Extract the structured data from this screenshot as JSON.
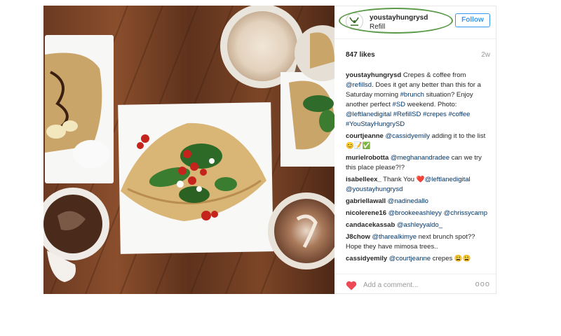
{
  "post": {
    "username": "youstayhungrysd",
    "location": "Refill",
    "follow_label": "Follow",
    "likes": "847 likes",
    "time_ago": "2w",
    "caption": {
      "user": "youstayhungrysd",
      "t1": " Crepes & coffee from ",
      "m1": "@refillsd",
      "t2": ". Does it get any better than this for a Saturday morning ",
      "h1": "#brunch",
      "t3": " situation? Enjoy another perfect ",
      "h2": "#SD",
      "t4": " weekend. Photo: ",
      "m2": "@leftlanedigital",
      "t5": " ",
      "h3": "#RefillSD",
      "t6": " ",
      "h4": "#crepes",
      "t7": " ",
      "h5": "#coffee",
      "t8": " ",
      "h6": "#YouStayHungrySD"
    },
    "comments": [
      {
        "user": "courtjeanne",
        "mention": "@cassidyemily",
        "text": " adding it to the list 😊📝✅"
      },
      {
        "user": "murielrobotta",
        "mention": "@meghanandradee",
        "text": " can we try this place please?!?"
      },
      {
        "user": "isabelleex_",
        "text": " Thank You ❤️",
        "mention": "@leftlanedigital",
        "mention2": "@youstayhungrysd"
      },
      {
        "user": "gabriellawall",
        "mention": "@nadinedallo"
      },
      {
        "user": "nicolerene16",
        "mention": "@brookeeashleyy",
        "mention2": "@chrissycamp"
      },
      {
        "user": "candacekassab",
        "mention": "@ashleyyaldo_"
      },
      {
        "user": "J8chow",
        "mention": "@tharealkimye",
        "text": " next brunch spot?? Hope they have mimosa trees.."
      },
      {
        "user": "cassidyemily",
        "mention": "@courtjeanne",
        "text": " crepes 😩😩"
      }
    ],
    "add_comment_placeholder": "Add a comment...",
    "more_label": "ooo"
  },
  "icons": {
    "avatar": "youstayhungry-logo-icon",
    "heart": "heart-icon",
    "more": "more-options-icon"
  },
  "colors": {
    "follow_blue": "#3897f0",
    "link_blue": "#003569",
    "heart_red": "#ed4956",
    "highlight_ring": "#5a9a48"
  }
}
